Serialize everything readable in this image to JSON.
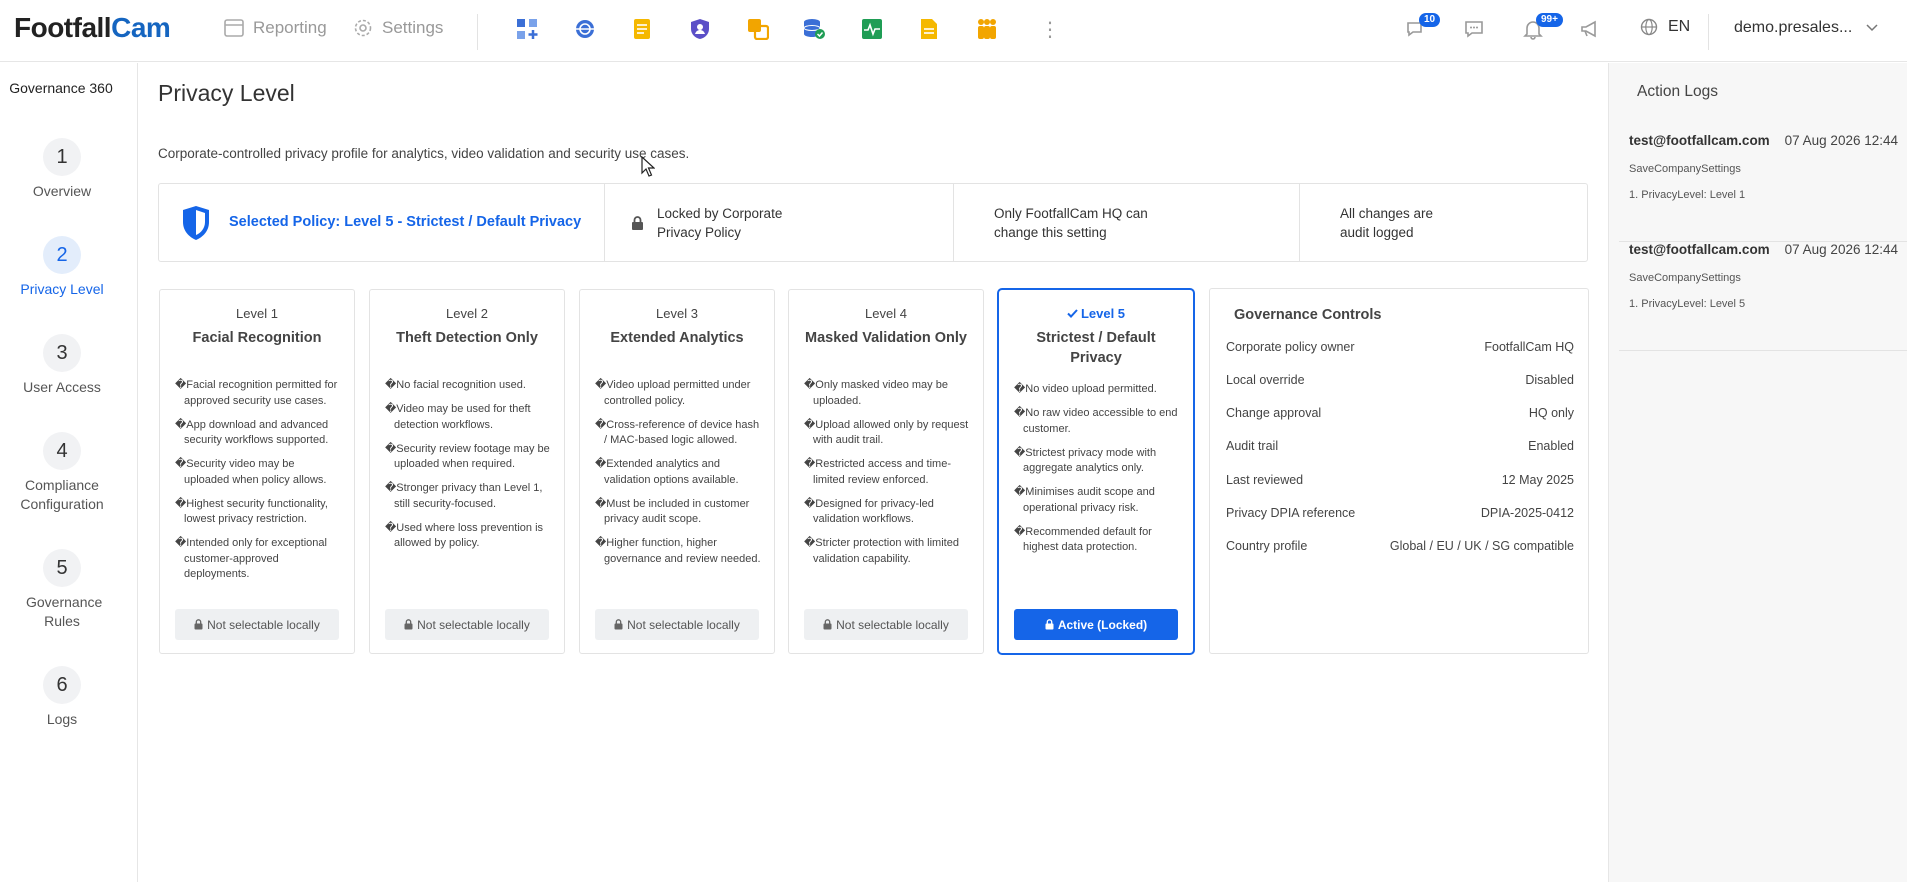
{
  "header": {
    "logo_part1": "Footfall",
    "logo_part2": "Cam",
    "nav_reporting": "Reporting",
    "nav_settings": "Settings",
    "notif_badge_1": "10",
    "notif_badge_2": "99+",
    "language": "EN",
    "user": "demo.presales..."
  },
  "sidebar": {
    "title": "Governance 360",
    "steps": [
      {
        "num": "1",
        "label": "Overview"
      },
      {
        "num": "2",
        "label": "Privacy Level"
      },
      {
        "num": "3",
        "label": "User Access"
      },
      {
        "num": "4",
        "label": "Compliance Configuration"
      },
      {
        "num": "5",
        "label": "Governance Rules"
      },
      {
        "num": "6",
        "label": "Logs"
      }
    ]
  },
  "main": {
    "title": "Privacy Level",
    "description": "Corporate-controlled privacy profile for analytics, video validation and security use cases.",
    "policy_bar": {
      "selected": "Selected Policy: Level 5 - Strictest / Default Privacy",
      "locked_line1": "Locked by Corporate",
      "locked_line2": "Privacy Policy",
      "hq_line1": "Only FootfallCam HQ can",
      "hq_line2": "change this setting",
      "audit_line1": "All changes are",
      "audit_line2": "audit logged"
    },
    "levels": [
      {
        "level": "Level 1",
        "name": "Facial Recognition",
        "items": [
          "�Facial recognition permitted for approved security use cases.",
          "�App download and advanced security workflows supported.",
          "�Security video may be uploaded when policy allows.",
          "�Highest security functionality, lowest privacy restriction.",
          "�Intended only for exceptional customer-approved deployments."
        ],
        "button": "Not selectable locally"
      },
      {
        "level": "Level 2",
        "name": "Theft Detection Only",
        "items": [
          "�No facial recognition used.",
          "�Video may be used for theft detection workflows.",
          "�Security review footage may be uploaded when required.",
          "�Stronger privacy than Level 1, still security-focused.",
          "�Used where loss prevention is allowed by policy."
        ],
        "button": "Not selectable locally"
      },
      {
        "level": "Level 3",
        "name": "Extended Analytics",
        "items": [
          "�Video upload permitted under controlled policy.",
          "�Cross-reference of device hash / MAC-based logic allowed.",
          "�Extended analytics and validation options available.",
          "�Must be included in customer privacy audit scope.",
          "�Higher function, higher governance and review needed."
        ],
        "button": "Not selectable locally"
      },
      {
        "level": "Level 4",
        "name": "Masked Validation Only",
        "items": [
          "�Only masked video may be uploaded.",
          "�Upload allowed only by request with audit trail.",
          "�Restricted access and time-limited review enforced.",
          "�Designed for privacy-led validation workflows.",
          "�Stricter protection with limited validation capability."
        ],
        "button": "Not selectable locally"
      },
      {
        "level": "Level 5",
        "name": "Strictest / Default Privacy",
        "items": [
          "�No video upload permitted.",
          "�No raw video accessible to end customer.",
          "�Strictest privacy mode with aggregate analytics only.",
          "�Minimises audit scope and operational privacy risk.",
          "�Recommended default for highest data protection."
        ],
        "button": "Active (Locked)"
      }
    ],
    "governance": {
      "title": "Governance Controls",
      "rows": [
        {
          "label": "Corporate policy owner",
          "value": "FootfallCam HQ"
        },
        {
          "label": "Local override",
          "value": "Disabled"
        },
        {
          "label": "Change approval",
          "value": "HQ only"
        },
        {
          "label": "Audit trail",
          "value": "Enabled"
        },
        {
          "label": "Last reviewed",
          "value": "12 May 2025"
        },
        {
          "label": "Privacy DPIA reference",
          "value": "DPIA-2025-0412"
        },
        {
          "label": "Country profile",
          "value": "Global / EU / UK / SG compatible"
        }
      ]
    }
  },
  "action_logs": {
    "title": "Action Logs",
    "entries": [
      {
        "user": "test@footfallcam.com",
        "time": "07 Aug 2026 12:44",
        "action": "SaveCompanySettings",
        "detail": "1. PrivacyLevel: Level 1"
      },
      {
        "user": "test@footfallcam.com",
        "time": "07 Aug 2026 12:44",
        "action": "SaveCompanySettings",
        "detail": "1. PrivacyLevel: Level 5"
      }
    ]
  },
  "colors": {
    "accent": "#1565e8",
    "logo_blue": "#1565c0",
    "app_yellow": "#f5b800",
    "app_blue": "#3b6fd6",
    "app_purple": "#5b4fc7",
    "app_green": "#1f9d55",
    "app_orange": "#f2a500"
  },
  "icons": [
    "reporting-icon",
    "settings-icon",
    "dashboard-add-icon",
    "globe-scan-icon",
    "notes-icon",
    "shield-user-icon",
    "layers-icon",
    "database-check-icon",
    "pulse-chart-icon",
    "document-icon",
    "people-group-icon",
    "more-vertical-icon",
    "chat-icon",
    "message-icon",
    "bell-icon",
    "megaphone-icon",
    "globe-icon",
    "chevron-down-icon",
    "shield-icon",
    "lock-icon",
    "check-icon"
  ]
}
